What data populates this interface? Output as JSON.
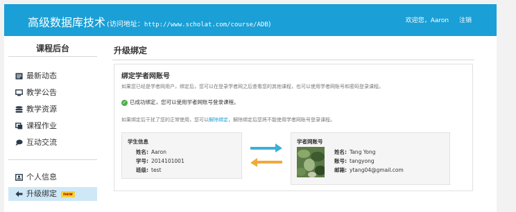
{
  "header": {
    "title": "高级数据库技术",
    "subtitle_prefix": "(访问地址：",
    "url": "http://www.scholat.com/course/ADB",
    "subtitle_suffix": ")",
    "welcome": "欢迎您，Aaron",
    "logout": "注销"
  },
  "sidebar": {
    "title": "课程后台",
    "items": [
      {
        "label": "最新动态",
        "icon": "news-icon"
      },
      {
        "label": "教学公告",
        "icon": "announcement-icon"
      },
      {
        "label": "教学资源",
        "icon": "database-icon"
      },
      {
        "label": "课程作业",
        "icon": "copy-icon"
      },
      {
        "label": "互动交流",
        "icon": "chat-icon"
      }
    ],
    "items2": [
      {
        "label": "个人信息",
        "icon": "id-card-icon"
      },
      {
        "label": "升级绑定",
        "icon": "arrow-left-icon",
        "badge": "new",
        "active": true
      }
    ]
  },
  "main": {
    "title": "升级绑定",
    "card": {
      "title": "绑定学者网账号",
      "description": "如果您已经是学者网用户，绑定后，您可以在登录学者网之后查看您的其他课程，也可以使用学者网账号和密码登录课程。",
      "success": "已成功绑定，您可以使用学者网账号登录课程。",
      "unbind_prefix": "如果绑定后干扰了您的正常使用，您可以",
      "unbind_link": "解除绑定",
      "unbind_suffix": "，解除绑定后您将不能使用学者网账号登录课程。"
    },
    "student": {
      "title": "学生信息",
      "name_label": "姓名:",
      "name": "Aaron",
      "id_label": "学号:",
      "id": "2014101001",
      "class_label": "班级:",
      "class": "test"
    },
    "scholat": {
      "title": "学者网账号",
      "name_label": "姓名:",
      "name": "Tang Yong",
      "account_label": "账号:",
      "account": "tangyong",
      "email_label": "邮箱:",
      "email": "ytang04@gmail.com"
    }
  },
  "colors": {
    "header_bg": "#1a9fd6",
    "arrow_right": "#3bb0d8",
    "arrow_left": "#f0a93a",
    "success": "#4cae4c",
    "active_bg": "#cfe8f7"
  }
}
